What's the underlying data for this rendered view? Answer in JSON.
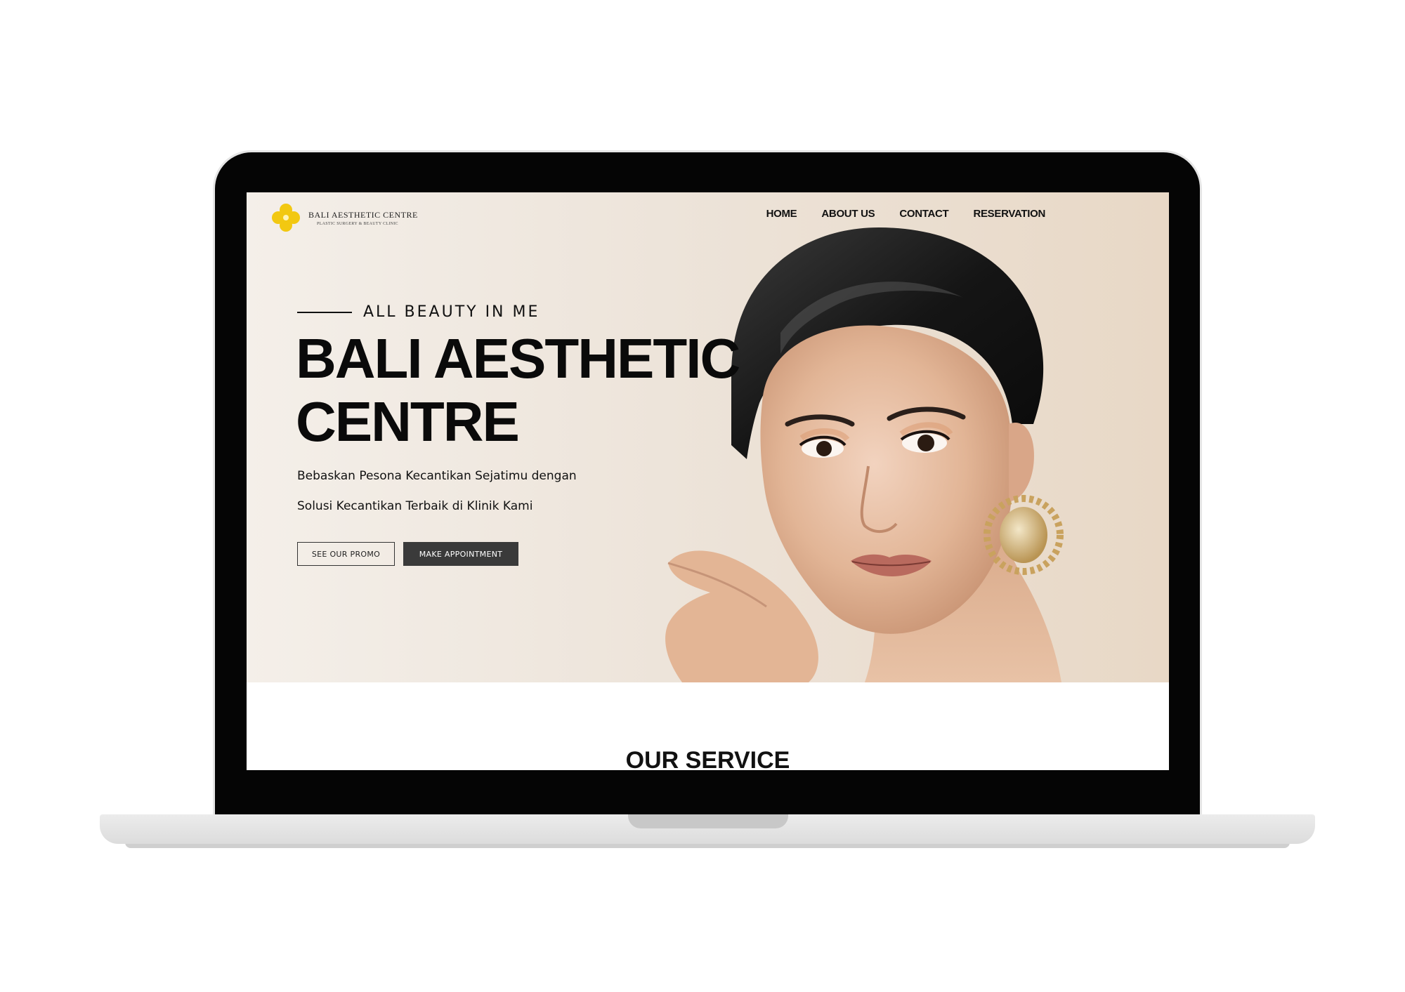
{
  "brand": {
    "name": "BALI AESTHETIC CENTRE",
    "subtitle": "PLASTIC SURGERY & BEAUTY CLINIC",
    "logo_icon": "flower-logo-icon",
    "logo_color": "#f2c811"
  },
  "nav": {
    "items": [
      {
        "label": "HOME"
      },
      {
        "label": "ABOUT US"
      },
      {
        "label": "CONTACT"
      },
      {
        "label": "RESERVATION"
      }
    ]
  },
  "hero": {
    "tagline": "ALL BEAUTY IN ME",
    "headline_line1": "BALI AESTHETIC",
    "headline_line2": "CENTRE",
    "sub_line1": "Bebaskan Pesona Kecantikan Sejatimu dengan",
    "sub_line2": "Solusi Kecantikan Terbaik di Klinik Kami",
    "promo_button": "SEE OUR PROMO",
    "appointment_button": "MAKE APPOINTMENT"
  },
  "services": {
    "title": "OUR SERVICE"
  },
  "colors": {
    "button_dark": "#3a3a3a",
    "hero_background": "#ede4da"
  }
}
